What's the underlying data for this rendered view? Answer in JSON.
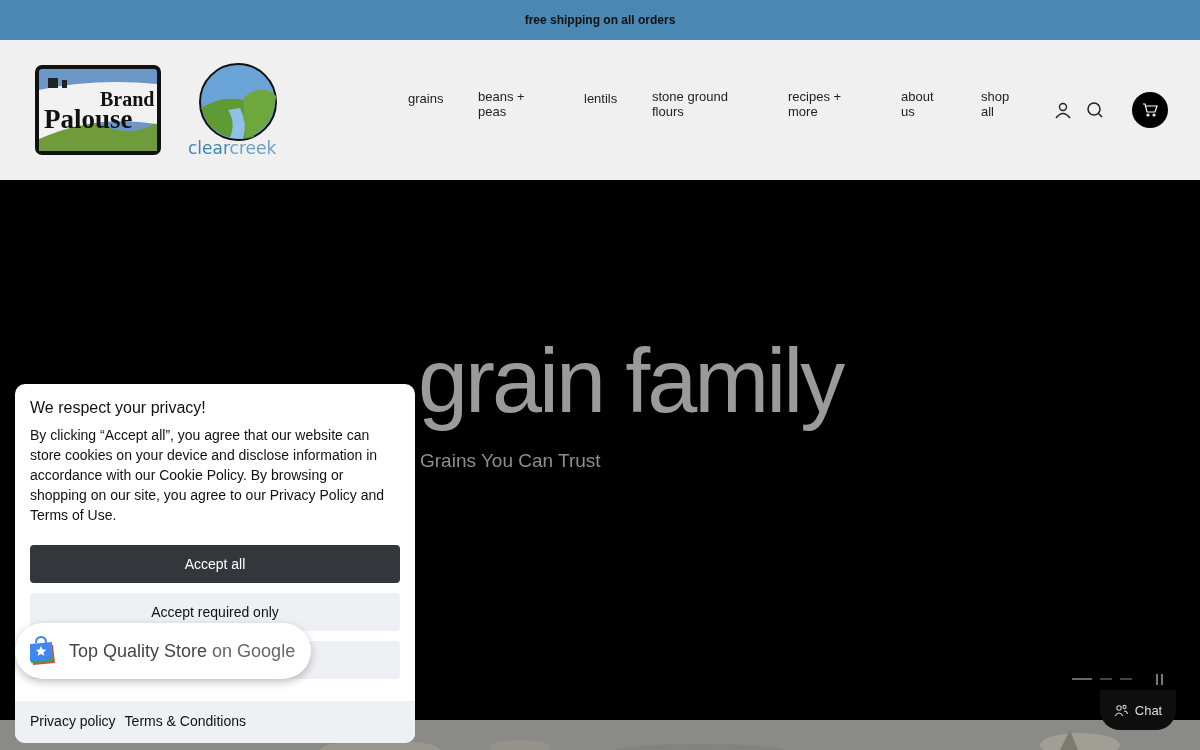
{
  "announcement": "free shipping on all orders",
  "logos": [
    {
      "kind": "palouse",
      "words": [
        "Palouse",
        "Brand"
      ]
    },
    {
      "kind": "creek",
      "words": [
        "clear",
        "creek"
      ]
    }
  ],
  "nav": [
    "grains",
    "beans + peas",
    "lentils",
    "stone ground flours",
    "recipes + more",
    "about us",
    "shop all"
  ],
  "hero": {
    "title": "grain family",
    "subtitle": "Grains You Can Trust",
    "slides": [
      {
        "selected": true
      },
      {
        "selected": false
      },
      {
        "selected": false
      }
    ]
  },
  "cookie": {
    "title": "We respect your privacy!",
    "body": "By clicking “Accept all”, you agree that our website can store cookies on your device and disclose information in accordance with our Cookie Policy. By browsing or shopping on our site, you agree to our Privacy Policy and Terms of Use.",
    "buttons": [
      {
        "kind": "primary",
        "label": "Accept all"
      },
      {
        "kind": "secondary",
        "label": "Accept required only"
      },
      {
        "kind": "blank"
      }
    ],
    "links": [
      "Privacy policy",
      "Terms & Conditions"
    ]
  },
  "google_badge": {
    "label": "Top Quality Store",
    "suffix": "on Google"
  },
  "chat": {
    "label": "Chat"
  }
}
